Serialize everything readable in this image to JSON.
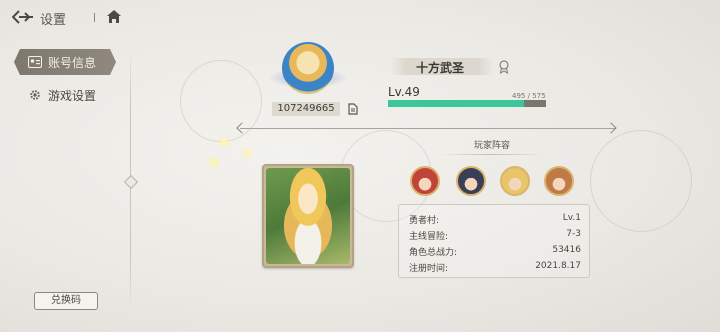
{
  "header": {
    "title": "设置"
  },
  "sidebar": {
    "items": [
      {
        "label": "账号信息",
        "icon": "id-card-icon",
        "active": true
      },
      {
        "label": "游戏设置",
        "icon": "gear-icon",
        "active": false
      }
    ],
    "redeem_label": "兑换码"
  },
  "profile": {
    "uid": "107249665",
    "name": "十方武圣",
    "level": "Lv.49",
    "exp_text": "495 / 575",
    "exp_fraction": 0.861
  },
  "lineup": {
    "title": "玩家阵容",
    "heroes": [
      {
        "name": "hero-red-hair",
        "color": "#c0443a"
      },
      {
        "name": "hero-dark-hair",
        "color": "#3a3f58"
      },
      {
        "name": "hero-blonde",
        "color": "#e8c46a"
      },
      {
        "name": "hero-brown-hair",
        "color": "#c07a48"
      }
    ]
  },
  "stats": [
    {
      "key": "勇者村:",
      "value": "Lv.1"
    },
    {
      "key": "主线冒险:",
      "value": "7-3"
    },
    {
      "key": "角色总战力:",
      "value": "53416"
    },
    {
      "key": "注册时间:",
      "value": "2021.8.17"
    }
  ],
  "colors": {
    "exp_bar": "#3cc69a",
    "accent_gold": "#d9b46a"
  }
}
